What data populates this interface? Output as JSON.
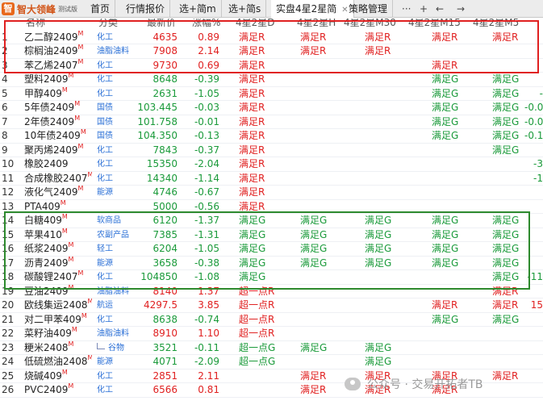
{
  "app": {
    "logo_text": "智大领峰",
    "logo_sub": "测试版"
  },
  "tabs": [
    {
      "label": "首页"
    },
    {
      "label": "行情报价"
    },
    {
      "label": "选+简m"
    },
    {
      "label": "选+简s"
    },
    {
      "label": "实盘4星2星简",
      "active": true
    },
    {
      "label": "策略管理"
    }
  ],
  "toolbar": {
    "more": "···",
    "add": "+",
    "back": "←",
    "forward": "→"
  },
  "columns": [
    "名称",
    "分类",
    "最新价",
    "涨幅%",
    "4星2星D",
    "4星2星H",
    "4星2星M30",
    "4星2星M15",
    "4星2星M5"
  ],
  "rows": [
    {
      "idx": "1",
      "name": "乙二醇2409",
      "sup": "M",
      "cat": "化工",
      "price": "4635",
      "chg": "0.89",
      "d": "满足R",
      "h": "满足R",
      "m30": "满足R",
      "m15": "满足R",
      "m5": "满足R",
      "x": ""
    },
    {
      "idx": "2",
      "name": "棕榈油2409",
      "sup": "M",
      "cat": "油脂油料",
      "price": "7908",
      "chg": "2.14",
      "d": "满足R",
      "h": "满足R",
      "m30": "满足R",
      "m15": "",
      "m5": "",
      "x": ""
    },
    {
      "idx": "3",
      "name": "苯乙烯2407",
      "sup": "M",
      "cat": "化工",
      "price": "9730",
      "chg": "0.69",
      "d": "满足R",
      "h": "",
      "m30": "",
      "m15": "满足R",
      "m5": "",
      "x": ""
    },
    {
      "idx": "4",
      "name": "塑料2409",
      "sup": "M",
      "cat": "化工",
      "price": "8648",
      "chg": "-0.39",
      "d": "满足R",
      "h": "",
      "m30": "",
      "m15": "满足G",
      "m5": "满足G",
      "x": ""
    },
    {
      "idx": "5",
      "name": "甲醇409",
      "sup": "M",
      "cat": "化工",
      "price": "2631",
      "chg": "-1.05",
      "d": "满足R",
      "h": "",
      "m30": "",
      "m15": "满足G",
      "m5": "满足G",
      "x": "-"
    },
    {
      "idx": "6",
      "name": "5年债2409",
      "sup": "M",
      "cat": "国债",
      "price": "103.445",
      "chg": "-0.03",
      "d": "满足R",
      "h": "",
      "m30": "",
      "m15": "满足G",
      "m5": "满足G",
      "x": "-0.0"
    },
    {
      "idx": "7",
      "name": "2年债2409",
      "sup": "M",
      "cat": "国债",
      "price": "101.758",
      "chg": "-0.01",
      "d": "满足R",
      "h": "",
      "m30": "",
      "m15": "满足G",
      "m5": "满足G",
      "x": "-0.0"
    },
    {
      "idx": "8",
      "name": "10年债2409",
      "sup": "M",
      "cat": "国债",
      "price": "104.350",
      "chg": "-0.13",
      "d": "满足R",
      "h": "",
      "m30": "",
      "m15": "满足G",
      "m5": "满足G",
      "x": "-0.1"
    },
    {
      "idx": "9",
      "name": "聚丙烯2409",
      "sup": "M",
      "cat": "化工",
      "price": "7843",
      "chg": "-0.37",
      "d": "满足R",
      "h": "",
      "m30": "",
      "m15": "",
      "m5": "满足G",
      "x": ""
    },
    {
      "idx": "10",
      "name": "橡胶2409",
      "sup": "",
      "cat": "化工",
      "price": "15350",
      "chg": "-2.04",
      "d": "满足R",
      "h": "",
      "m30": "",
      "m15": "",
      "m5": "",
      "x": "-3"
    },
    {
      "idx": "11",
      "name": "合成橡胶2407",
      "sup": "M",
      "cat": "化工",
      "price": "14340",
      "chg": "-1.14",
      "d": "满足R",
      "h": "",
      "m30": "",
      "m15": "",
      "m5": "",
      "x": "-1"
    },
    {
      "idx": "12",
      "name": "液化气2409",
      "sup": "M",
      "cat": "能源",
      "price": "4746",
      "chg": "-0.67",
      "d": "满足R",
      "h": "",
      "m30": "",
      "m15": "",
      "m5": "",
      "x": ""
    },
    {
      "idx": "13",
      "name": "PTA409",
      "sup": "M",
      "cat": "",
      "price": "5000",
      "chg": "-0.56",
      "d": "满足R",
      "h": "",
      "m30": "",
      "m15": "",
      "m5": "",
      "x": ""
    },
    {
      "idx": "14",
      "name": "白糖409",
      "sup": "M",
      "cat": "软商品",
      "price": "6120",
      "chg": "-1.37",
      "d": "满足G",
      "h": "满足G",
      "m30": "满足G",
      "m15": "满足G",
      "m5": "满足G",
      "x": ""
    },
    {
      "idx": "15",
      "name": "苹果410",
      "sup": "M",
      "cat": "农副产品",
      "price": "7385",
      "chg": "-1.31",
      "d": "满足G",
      "h": "满足G",
      "m30": "满足G",
      "m15": "满足G",
      "m5": "满足G",
      "x": ""
    },
    {
      "idx": "16",
      "name": "纸浆2409",
      "sup": "M",
      "cat": "轻工",
      "price": "6204",
      "chg": "-1.05",
      "d": "满足G",
      "h": "满足G",
      "m30": "满足G",
      "m15": "满足G",
      "m5": "满足G",
      "x": ""
    },
    {
      "idx": "17",
      "name": "沥青2409",
      "sup": "M",
      "cat": "能源",
      "price": "3658",
      "chg": "-0.38",
      "d": "满足G",
      "h": "满足G",
      "m30": "满足G",
      "m15": "满足G",
      "m5": "满足G",
      "x": ""
    },
    {
      "idx": "18",
      "name": "碳酸锂2407",
      "sup": "M",
      "cat": "化工",
      "price": "104850",
      "chg": "-1.08",
      "d": "满足G",
      "h": "",
      "m30": "",
      "m15": "",
      "m5": "满足G",
      "x": "-11"
    },
    {
      "idx": "19",
      "name": "豆油2409",
      "sup": "M",
      "cat": "油脂油料",
      "price": "8140",
      "chg": "1.37",
      "d": "超一点R",
      "h": "",
      "m30": "",
      "m15": "",
      "m5": "满足R",
      "x": ""
    },
    {
      "idx": "20",
      "name": "欧线集运2408",
      "sup": "M",
      "cat": "航运",
      "price": "4297.5",
      "chg": "3.85",
      "d": "超一点R",
      "h": "",
      "m30": "",
      "m15": "满足R",
      "m5": "满足R",
      "x": "15"
    },
    {
      "idx": "21",
      "name": "对二甲苯409",
      "sup": "M",
      "cat": "化工",
      "price": "8638",
      "chg": "-0.74",
      "d": "超一点R",
      "h": "",
      "m30": "",
      "m15": "满足G",
      "m5": "满足G",
      "x": ""
    },
    {
      "idx": "22",
      "name": "菜籽油409",
      "sup": "M",
      "cat": "油脂油料",
      "price": "8910",
      "chg": "1.10",
      "d": "超一点R",
      "h": "",
      "m30": "",
      "m15": "",
      "m5": "",
      "x": ""
    },
    {
      "idx": "23",
      "name": "粳米2408",
      "sup": "M",
      "cat": "谷物",
      "price": "3521",
      "chg": "-0.11",
      "d": "超一点G",
      "h": "满足G",
      "m30": "满足G",
      "m15": "",
      "m5": "",
      "x": "",
      "trend": true
    },
    {
      "idx": "24",
      "name": "低硫燃油2408",
      "sup": "M",
      "cat": "能源",
      "price": "4071",
      "chg": "-2.09",
      "d": "超一点G",
      "h": "",
      "m30": "满足G",
      "m15": "",
      "m5": "",
      "x": ""
    },
    {
      "idx": "25",
      "name": "烧碱409",
      "sup": "M",
      "cat": "化工",
      "price": "2851",
      "chg": "2.11",
      "d": "",
      "h": "满足R",
      "m30": "满足R",
      "m15": "满足R",
      "m5": "满足R",
      "x": ""
    },
    {
      "idx": "26",
      "name": "PVC2409",
      "sup": "M",
      "cat": "化工",
      "price": "6566",
      "chg": "0.81",
      "d": "",
      "h": "满足R",
      "m30": "满足R",
      "m15": "满足R",
      "m5": "",
      "x": ""
    }
  ],
  "watermark": {
    "text": "公众号 · 交易开拓者TB"
  },
  "colors": {
    "up": "#e02020",
    "down": "#1a9a3a",
    "category": "#2a6fd6",
    "red_box": "#e02020",
    "green_box": "#2e8a2e"
  }
}
